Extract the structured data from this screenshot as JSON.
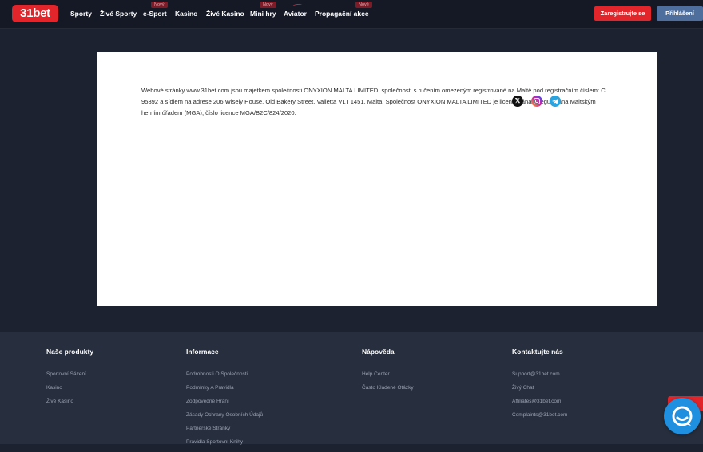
{
  "header": {
    "logo": "31bet",
    "nav": [
      {
        "label": "Sporty",
        "badge": ""
      },
      {
        "label": "Živé Sporty",
        "badge": ""
      },
      {
        "label": "e-Sport",
        "badge": "Nový"
      },
      {
        "label": "Kasino",
        "badge": ""
      },
      {
        "label": "Živé Kasino",
        "badge": ""
      },
      {
        "label": "Mini hry",
        "badge": "Nový"
      },
      {
        "label": "Aviator",
        "badge": ""
      },
      {
        "label": "Propagační akce",
        "badge": "Nové"
      }
    ],
    "register_label": "Zaregistrujte se",
    "login_label": "Přihlášení"
  },
  "content": {
    "paragraph": "Webové stránky www.31bet.com jsou majetkem společnosti ONYXION MALTA LIMITED, společnosti s ručením omezeným registrované na Maltě pod registračním číslem: C 95392 a sídlem na adrese 206 Wisely House, Old Bakery Street, Valletta VLT 1451, Malta. Společnost ONYXION MALTA LIMITED je licencována a regulována Maltským herním úřadem (MGA), číslo licence MGA/B2C/824/2020."
  },
  "footer": {
    "columns": [
      {
        "title": "Naše produkty",
        "links": [
          "Sportovní Sázení",
          "Kasino",
          "Živé Kasino"
        ]
      },
      {
        "title": "Informace",
        "links": [
          "Podrobnosti O Společnosti",
          "Podmínky A Pravidla",
          "Zodpovědné Hraní",
          "Zásady Ochrany Osobních Údajů",
          "Partnerské Stránky",
          "Pravidla Sportovní Knihy"
        ]
      },
      {
        "title": "Nápověda",
        "links": [
          "Help Center",
          "Často Kladené Otázky"
        ]
      },
      {
        "title": "Kontaktujte nás",
        "links": [
          "Support@31bet.com",
          "Živý Chat",
          "Affiliates@31bet.com",
          "Complaints@31bet.com"
        ]
      }
    ],
    "social_icons": [
      "x-icon",
      "instagram-icon",
      "telegram-icon"
    ]
  },
  "widgets": {
    "promo_strip_text": "B",
    "chat_icon": "chat-bubble-icon"
  },
  "colors": {
    "brand_red": "#e1252a",
    "login_blue": "#4e6e9d",
    "badge_red": "#7b1c28",
    "header_bg": "#141925",
    "page_bg": "#1c2230",
    "footer_bg": "#272e3d",
    "chat_blue": "#1f8fe0"
  }
}
